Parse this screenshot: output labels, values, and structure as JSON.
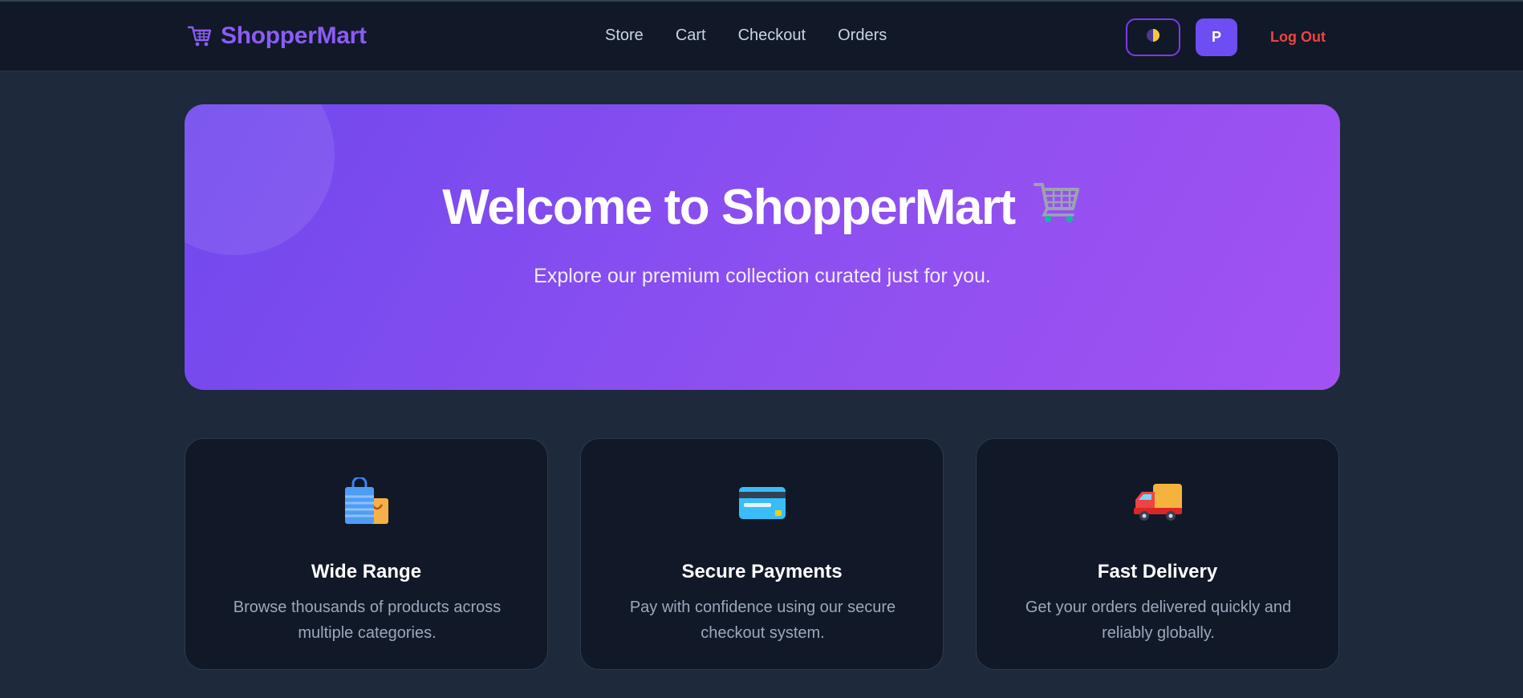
{
  "header": {
    "brand_name": "ShopperMart",
    "brand_icon": "shopping-cart-icon",
    "nav": [
      {
        "label": "Store"
      },
      {
        "label": "Cart"
      },
      {
        "label": "Checkout"
      },
      {
        "label": "Orders"
      }
    ],
    "theme_toggle_icon": "half-moon-contrast-icon",
    "avatar_initial": "P",
    "logout_label": "Log Out"
  },
  "hero": {
    "title": "Welcome to ShopperMart",
    "title_icon": "shopping-cart-icon",
    "subtitle": "Explore our premium collection curated just for you."
  },
  "features": [
    {
      "icon": "shopping-bags-icon",
      "title": "Wide Range",
      "desc": "Browse thousands of products across multiple categories."
    },
    {
      "icon": "credit-card-icon",
      "title": "Secure Payments",
      "desc": "Pay with confidence using our secure checkout system."
    },
    {
      "icon": "delivery-truck-icon",
      "title": "Fast Delivery",
      "desc": "Get your orders delivered quickly and reliably globally."
    }
  ],
  "colors": {
    "accent": "#8b5cf6",
    "danger": "#ef4444",
    "background": "#1e293b",
    "surface": "#111827"
  }
}
